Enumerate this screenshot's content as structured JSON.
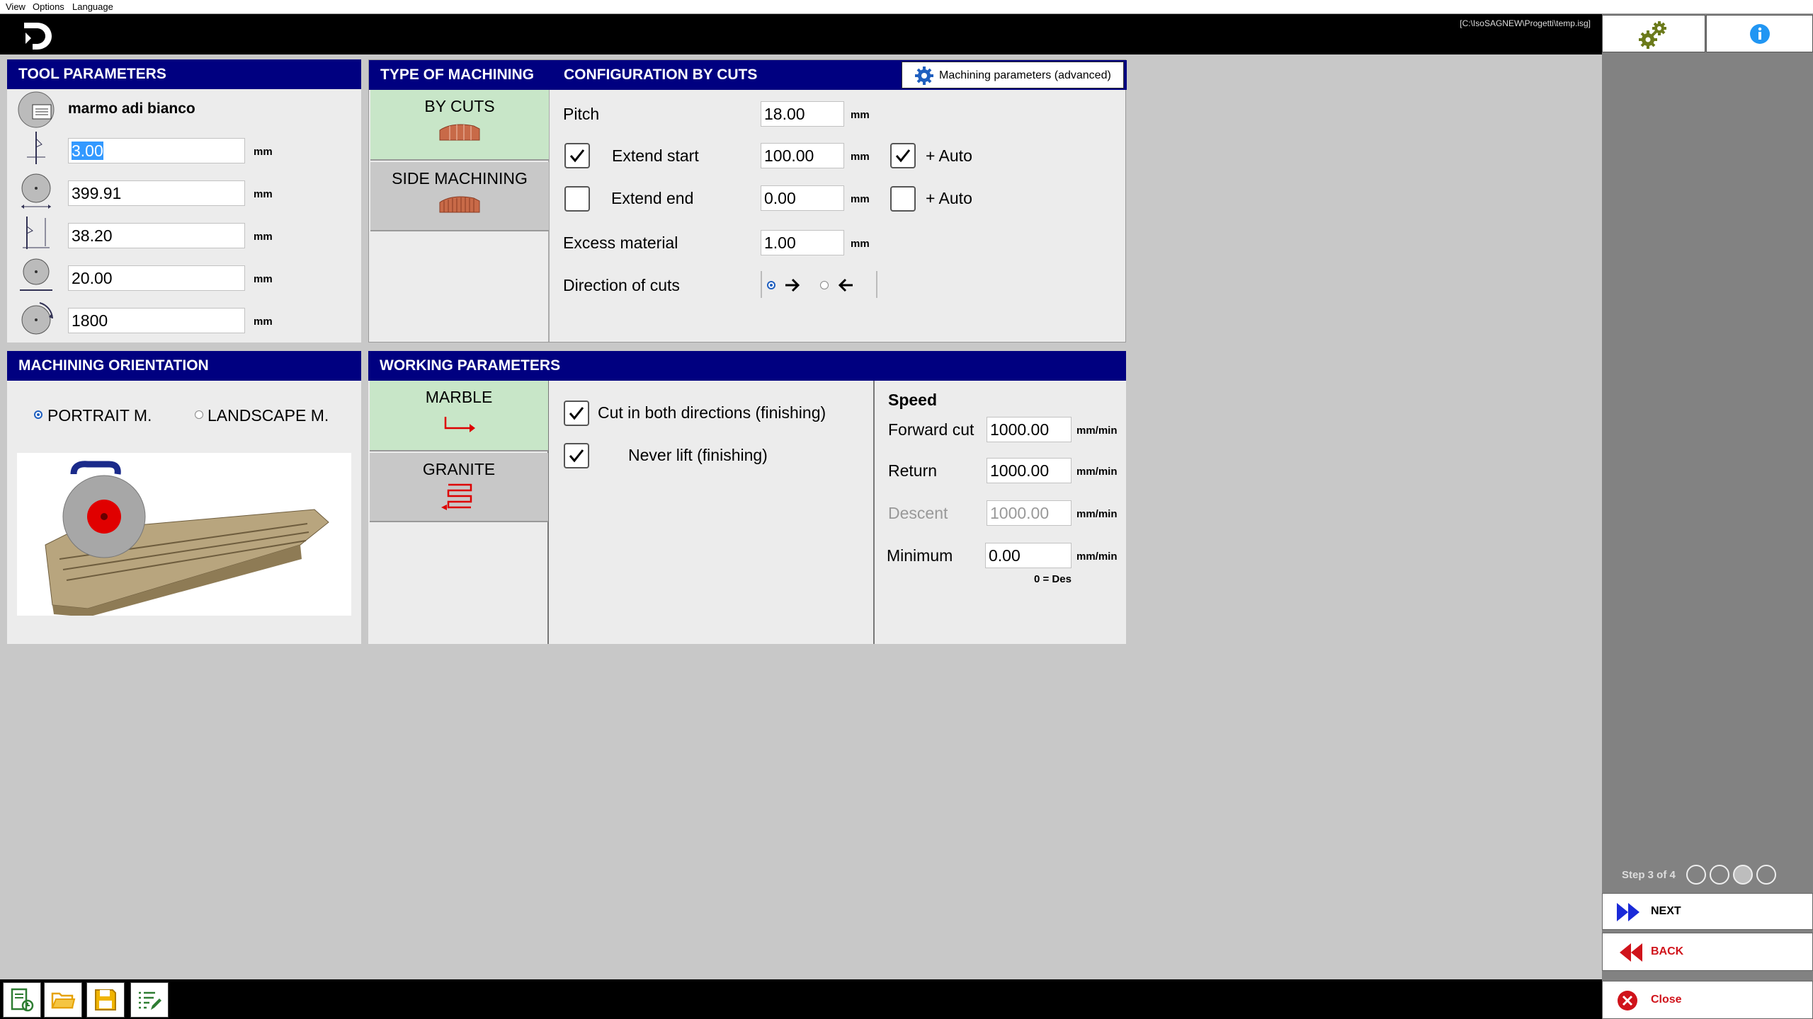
{
  "menu": [
    "View",
    "Options",
    "Language"
  ],
  "file_path": "[C:\\IsoSAGNEW\\Progetti\\temp.isg]",
  "tool_parameters": {
    "title": "TOOL PARAMETERS",
    "tool_name": "marmo adi bianco",
    "fields": [
      {
        "value": "3.00",
        "unit": "mm",
        "icon": "blade-thickness-icon"
      },
      {
        "value": "399.91",
        "unit": "mm",
        "icon": "blade-diameter-icon"
      },
      {
        "value": "38.20",
        "unit": "mm",
        "icon": "cut-depth-icon"
      },
      {
        "value": "20.00",
        "unit": "mm",
        "icon": "flange-diameter-icon"
      },
      {
        "value": "1800",
        "unit": "mm",
        "icon": "rotation-speed-icon"
      }
    ]
  },
  "type_of_machining": {
    "title": "TYPE OF MACHINING",
    "options": [
      "BY CUTS",
      "SIDE MACHINING"
    ],
    "selected": "BY CUTS"
  },
  "configuration": {
    "title": "CONFIGURATION BY CUTS",
    "advanced_button": "Machining parameters (advanced)",
    "pitch_label": "Pitch",
    "pitch_value": "18.00",
    "extend_start_label": "Extend start",
    "extend_start_value": "100.00",
    "extend_start_checked": true,
    "extend_end_label": "Extend end",
    "extend_end_value": "0.00",
    "extend_end_checked": false,
    "auto_label": "+ Auto",
    "auto_start_checked": true,
    "auto_end_checked": false,
    "excess_label": "Excess material",
    "excess_value": "1.00",
    "direction_label": "Direction of cuts",
    "direction_selected": "right",
    "unit": "mm"
  },
  "orientation": {
    "title": "MACHINING ORIENTATION",
    "portrait": "PORTRAIT M.",
    "landscape": "LANDSCAPE M.",
    "selected": "portrait"
  },
  "working": {
    "title": "WORKING PARAMETERS",
    "materials": [
      "MARBLE",
      "GRANITE"
    ],
    "selected_material": "MARBLE",
    "cut_both": "Cut in both directions (finishing)",
    "never_lift": "Never lift (finishing)",
    "speed_title": "Speed",
    "speed": [
      {
        "label": "Forward cut",
        "value": "1000.00",
        "unit": "mm/min",
        "enabled": true
      },
      {
        "label": "Return",
        "value": "1000.00",
        "unit": "mm/min",
        "enabled": true
      },
      {
        "label": "Descent",
        "value": "1000.00",
        "unit": "mm/min",
        "enabled": false
      },
      {
        "label": "Minimum",
        "value": "0.00",
        "unit": "mm/min",
        "enabled": true
      }
    ],
    "minimum_note": "0 = Des"
  },
  "step": {
    "label": "Step 3 of 4",
    "current": 3,
    "total": 4
  },
  "nav": {
    "next": "NEXT",
    "back": "BACK",
    "close": "Close"
  },
  "colors": {
    "header_blue": "#000080",
    "selected_green": "#c8e6c8",
    "accent_blue": "#1f5fbf",
    "close_red": "#d0131b"
  }
}
